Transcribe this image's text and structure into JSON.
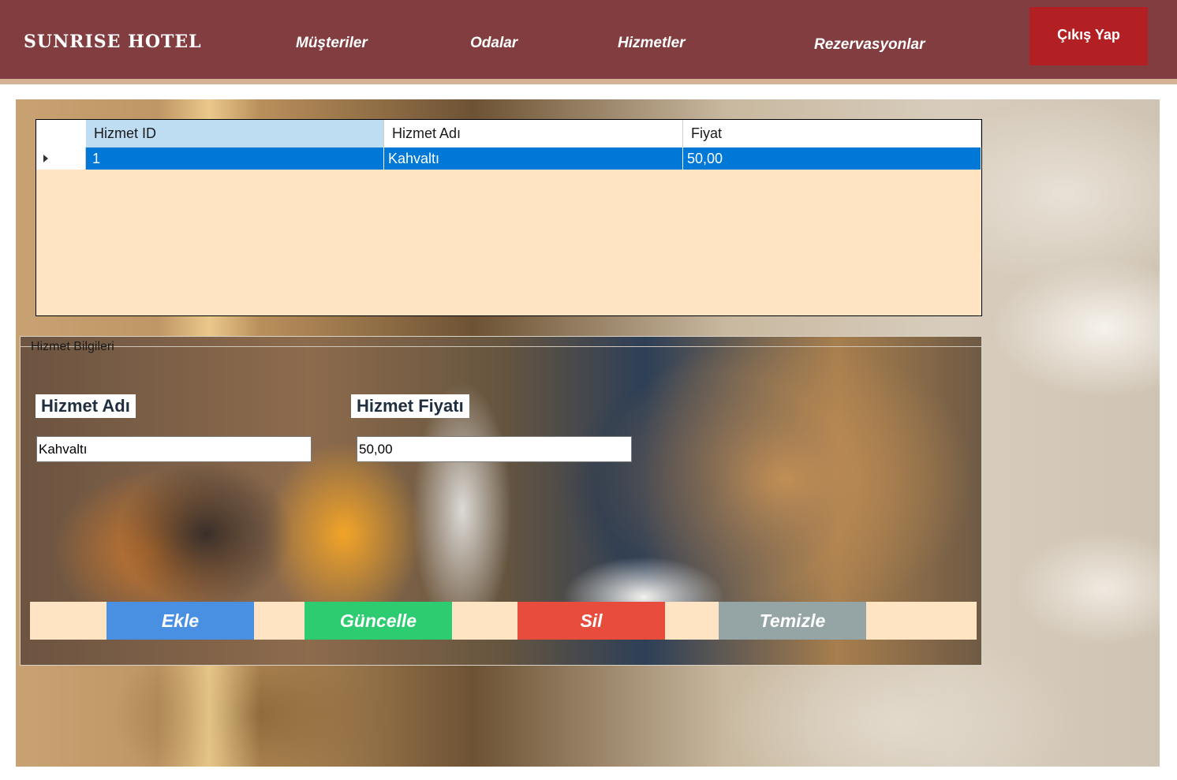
{
  "header": {
    "brand": "SUNRISE HOTEL",
    "nav": [
      "Müşteriler",
      "Odalar",
      "Hizmetler",
      "Rezervasyonlar"
    ],
    "logout_label": "Çıkış Yap",
    "colors": {
      "bar": "#813d3f",
      "stripe": "#d3b296",
      "logout": "#b32024"
    }
  },
  "grid": {
    "columns": [
      "Hizmet ID",
      "Hizmet Adı",
      "Fiyat"
    ],
    "rows": [
      [
        "1",
        "Kahvaltı",
        "50,00"
      ]
    ],
    "selected_row": 0,
    "colors": {
      "background": "#ffe4c4",
      "selection": "#0078d7",
      "active_header": "#bedcf2"
    }
  },
  "form": {
    "group_title": "Hizmet Bilgileri",
    "name_label": "Hizmet Adı",
    "name_value": "Kahvaltı",
    "price_label": "Hizmet Fiyatı",
    "price_value": "50,00"
  },
  "buttons": {
    "add": "Ekle",
    "update": "Güncelle",
    "delete": "Sil",
    "clear": "Temizle",
    "colors": {
      "add": "#4a90e2",
      "update": "#2ecc71",
      "delete": "#e74c3c",
      "clear": "#95a5a6"
    }
  }
}
